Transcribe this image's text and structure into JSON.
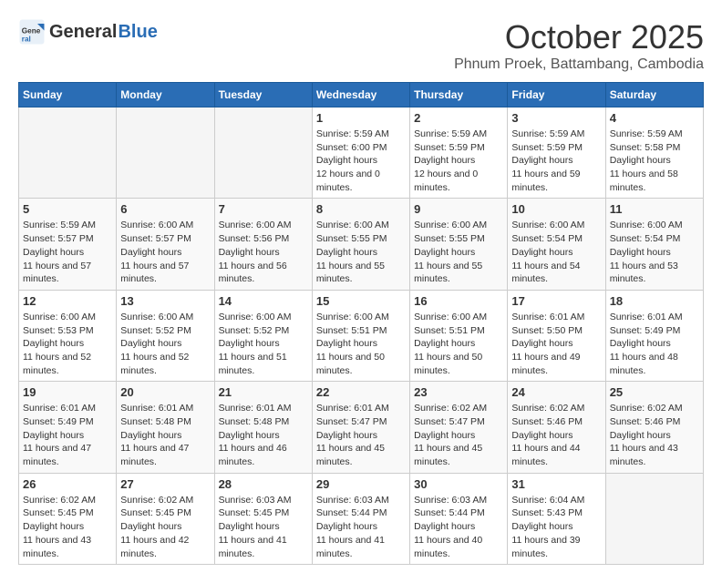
{
  "header": {
    "logo_general": "General",
    "logo_blue": "Blue",
    "month": "October 2025",
    "location": "Phnum Proek, Battambang, Cambodia"
  },
  "days_of_week": [
    "Sunday",
    "Monday",
    "Tuesday",
    "Wednesday",
    "Thursday",
    "Friday",
    "Saturday"
  ],
  "weeks": [
    [
      {
        "day": "",
        "info": ""
      },
      {
        "day": "",
        "info": ""
      },
      {
        "day": "",
        "info": ""
      },
      {
        "day": "1",
        "sunrise": "5:59 AM",
        "sunset": "6:00 PM",
        "daylight": "12 hours and 0 minutes."
      },
      {
        "day": "2",
        "sunrise": "5:59 AM",
        "sunset": "5:59 PM",
        "daylight": "12 hours and 0 minutes."
      },
      {
        "day": "3",
        "sunrise": "5:59 AM",
        "sunset": "5:59 PM",
        "daylight": "11 hours and 59 minutes."
      },
      {
        "day": "4",
        "sunrise": "5:59 AM",
        "sunset": "5:58 PM",
        "daylight": "11 hours and 58 minutes."
      }
    ],
    [
      {
        "day": "5",
        "sunrise": "5:59 AM",
        "sunset": "5:57 PM",
        "daylight": "11 hours and 57 minutes."
      },
      {
        "day": "6",
        "sunrise": "6:00 AM",
        "sunset": "5:57 PM",
        "daylight": "11 hours and 57 minutes."
      },
      {
        "day": "7",
        "sunrise": "6:00 AM",
        "sunset": "5:56 PM",
        "daylight": "11 hours and 56 minutes."
      },
      {
        "day": "8",
        "sunrise": "6:00 AM",
        "sunset": "5:55 PM",
        "daylight": "11 hours and 55 minutes."
      },
      {
        "day": "9",
        "sunrise": "6:00 AM",
        "sunset": "5:55 PM",
        "daylight": "11 hours and 55 minutes."
      },
      {
        "day": "10",
        "sunrise": "6:00 AM",
        "sunset": "5:54 PM",
        "daylight": "11 hours and 54 minutes."
      },
      {
        "day": "11",
        "sunrise": "6:00 AM",
        "sunset": "5:54 PM",
        "daylight": "11 hours and 53 minutes."
      }
    ],
    [
      {
        "day": "12",
        "sunrise": "6:00 AM",
        "sunset": "5:53 PM",
        "daylight": "11 hours and 52 minutes."
      },
      {
        "day": "13",
        "sunrise": "6:00 AM",
        "sunset": "5:52 PM",
        "daylight": "11 hours and 52 minutes."
      },
      {
        "day": "14",
        "sunrise": "6:00 AM",
        "sunset": "5:52 PM",
        "daylight": "11 hours and 51 minutes."
      },
      {
        "day": "15",
        "sunrise": "6:00 AM",
        "sunset": "5:51 PM",
        "daylight": "11 hours and 50 minutes."
      },
      {
        "day": "16",
        "sunrise": "6:00 AM",
        "sunset": "5:51 PM",
        "daylight": "11 hours and 50 minutes."
      },
      {
        "day": "17",
        "sunrise": "6:01 AM",
        "sunset": "5:50 PM",
        "daylight": "11 hours and 49 minutes."
      },
      {
        "day": "18",
        "sunrise": "6:01 AM",
        "sunset": "5:49 PM",
        "daylight": "11 hours and 48 minutes."
      }
    ],
    [
      {
        "day": "19",
        "sunrise": "6:01 AM",
        "sunset": "5:49 PM",
        "daylight": "11 hours and 47 minutes."
      },
      {
        "day": "20",
        "sunrise": "6:01 AM",
        "sunset": "5:48 PM",
        "daylight": "11 hours and 47 minutes."
      },
      {
        "day": "21",
        "sunrise": "6:01 AM",
        "sunset": "5:48 PM",
        "daylight": "11 hours and 46 minutes."
      },
      {
        "day": "22",
        "sunrise": "6:01 AM",
        "sunset": "5:47 PM",
        "daylight": "11 hours and 45 minutes."
      },
      {
        "day": "23",
        "sunrise": "6:02 AM",
        "sunset": "5:47 PM",
        "daylight": "11 hours and 45 minutes."
      },
      {
        "day": "24",
        "sunrise": "6:02 AM",
        "sunset": "5:46 PM",
        "daylight": "11 hours and 44 minutes."
      },
      {
        "day": "25",
        "sunrise": "6:02 AM",
        "sunset": "5:46 PM",
        "daylight": "11 hours and 43 minutes."
      }
    ],
    [
      {
        "day": "26",
        "sunrise": "6:02 AM",
        "sunset": "5:45 PM",
        "daylight": "11 hours and 43 minutes."
      },
      {
        "day": "27",
        "sunrise": "6:02 AM",
        "sunset": "5:45 PM",
        "daylight": "11 hours and 42 minutes."
      },
      {
        "day": "28",
        "sunrise": "6:03 AM",
        "sunset": "5:45 PM",
        "daylight": "11 hours and 41 minutes."
      },
      {
        "day": "29",
        "sunrise": "6:03 AM",
        "sunset": "5:44 PM",
        "daylight": "11 hours and 41 minutes."
      },
      {
        "day": "30",
        "sunrise": "6:03 AM",
        "sunset": "5:44 PM",
        "daylight": "11 hours and 40 minutes."
      },
      {
        "day": "31",
        "sunrise": "6:04 AM",
        "sunset": "5:43 PM",
        "daylight": "11 hours and 39 minutes."
      },
      {
        "day": "",
        "info": ""
      }
    ]
  ],
  "labels": {
    "sunrise": "Sunrise:",
    "sunset": "Sunset:",
    "daylight": "Daylight hours"
  }
}
